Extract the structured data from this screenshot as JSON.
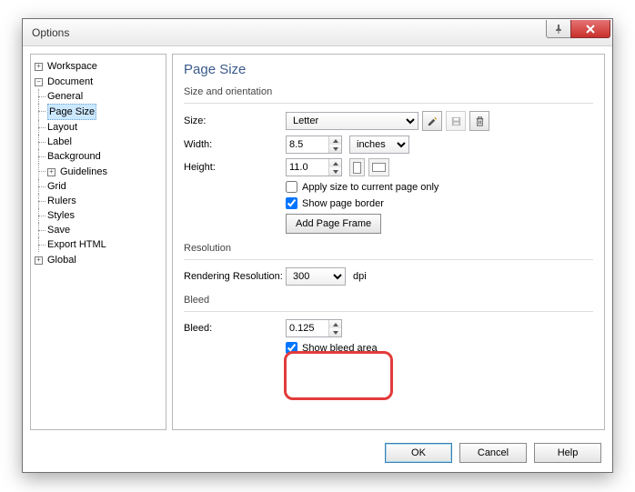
{
  "window": {
    "title": "Options"
  },
  "tree": {
    "workspace": "Workspace",
    "document": "Document",
    "general": "General",
    "page_size": "Page Size",
    "layout": "Layout",
    "label": "Label",
    "background": "Background",
    "guidelines": "Guidelines",
    "grid": "Grid",
    "rulers": "Rulers",
    "styles": "Styles",
    "save": "Save",
    "export_html": "Export HTML",
    "global": "Global"
  },
  "page": {
    "title": "Page Size",
    "size_orient": "Size and orientation",
    "size_label": "Size:",
    "size_value": "Letter",
    "width_label": "Width:",
    "width_value": "8.5",
    "units_value": "inches",
    "height_label": "Height:",
    "height_value": "11.0",
    "apply_current": "Apply size to current page only",
    "show_border": "Show page border",
    "add_frame": "Add Page Frame",
    "resolution": "Resolution",
    "render_res_label": "Rendering Resolution:",
    "render_res_value": "300",
    "dpi": "dpi",
    "bleed_group": "Bleed",
    "bleed_label": "Bleed:",
    "bleed_value": "0.125",
    "show_bleed": "Show bleed area"
  },
  "footer": {
    "ok": "OK",
    "cancel": "Cancel",
    "help": "Help"
  }
}
